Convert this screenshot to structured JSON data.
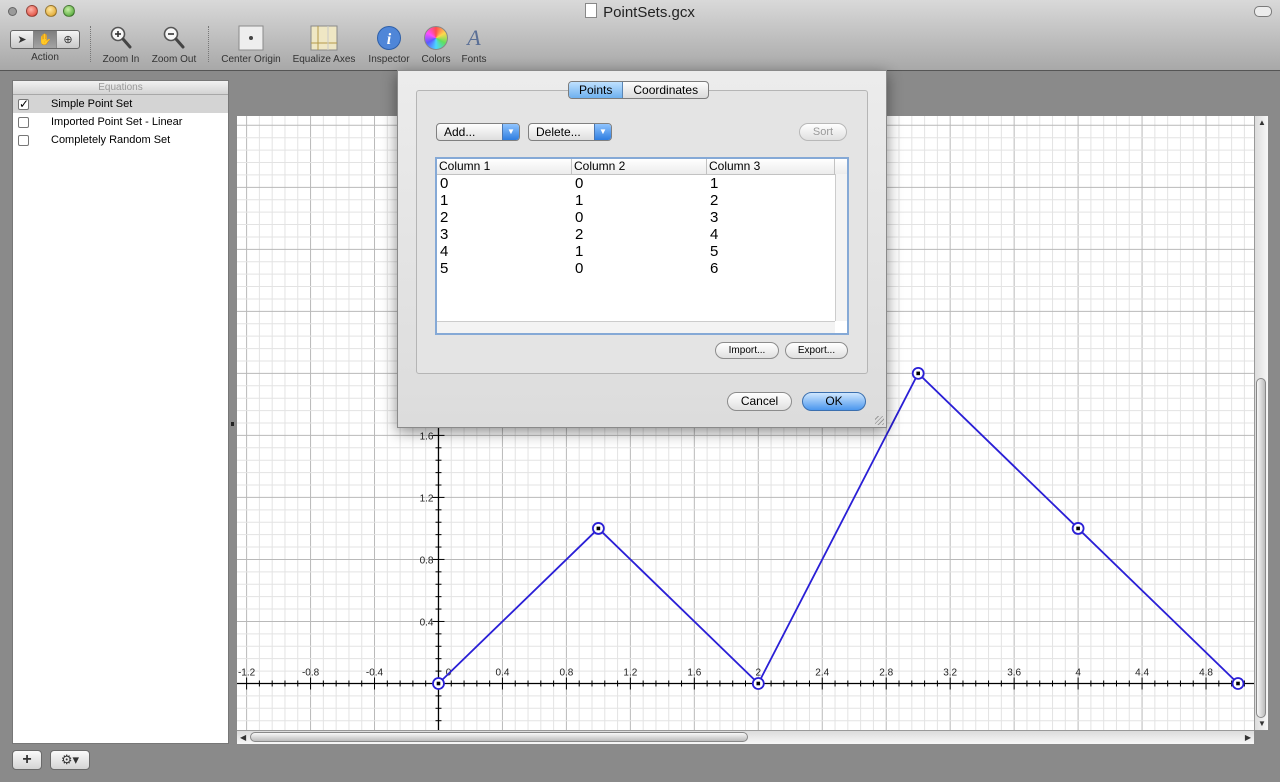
{
  "window": {
    "title": "PointSets.gcx"
  },
  "toolbar": {
    "action_label": "Action",
    "zoom_in_label": "Zoom In",
    "zoom_out_label": "Zoom Out",
    "center_origin_label": "Center Origin",
    "equalize_axes_label": "Equalize Axes",
    "inspector_label": "Inspector",
    "colors_label": "Colors",
    "fonts_label": "Fonts"
  },
  "sidebar": {
    "header": "Equations",
    "items": [
      {
        "label": "Simple Point Set",
        "checked": true,
        "selected": true
      },
      {
        "label": "Imported Point Set - Linear",
        "checked": false,
        "selected": false
      },
      {
        "label": "Completely Random Set",
        "checked": false,
        "selected": false
      }
    ],
    "add_label": "+",
    "gear_label": "⚙▾"
  },
  "dialog": {
    "tabs": [
      "Points",
      "Coordinates"
    ],
    "active_tab": "Points",
    "add_label": "Add...",
    "delete_label": "Delete...",
    "sort_label": "Sort",
    "columns": [
      "Column 1",
      "Column 2",
      "Column 3"
    ],
    "rows": [
      [
        "0",
        "0",
        "1"
      ],
      [
        "1",
        "1",
        "2"
      ],
      [
        "2",
        "0",
        "3"
      ],
      [
        "3",
        "2",
        "4"
      ],
      [
        "4",
        "1",
        "5"
      ],
      [
        "5",
        "0",
        "6"
      ]
    ],
    "import_label": "Import...",
    "export_label": "Export...",
    "cancel_label": "Cancel",
    "ok_label": "OK"
  },
  "chart_data": {
    "type": "line",
    "series": [
      {
        "values_xy": [
          [
            0,
            0
          ],
          [
            1,
            1
          ],
          [
            2,
            0
          ],
          [
            3,
            2
          ],
          [
            4,
            1
          ],
          [
            5,
            0
          ]
        ],
        "color": "#2a1fd6"
      }
    ],
    "xlim": [
      -1.26,
      5.1
    ],
    "ylim": [
      -0.3,
      3.66
    ],
    "x_ticks": [
      "-1.2",
      "-0.8",
      "-0.4",
      "0",
      "0.4",
      "0.8",
      "1.2",
      "1.6",
      "2",
      "2.4",
      "2.8",
      "3.2",
      "3.6",
      "4",
      "4.4",
      "4.8"
    ],
    "y_ticks": [
      "0.4",
      "0.8",
      "1.2",
      "1.6"
    ],
    "grid": true,
    "line_color": "#2a1fd6"
  }
}
